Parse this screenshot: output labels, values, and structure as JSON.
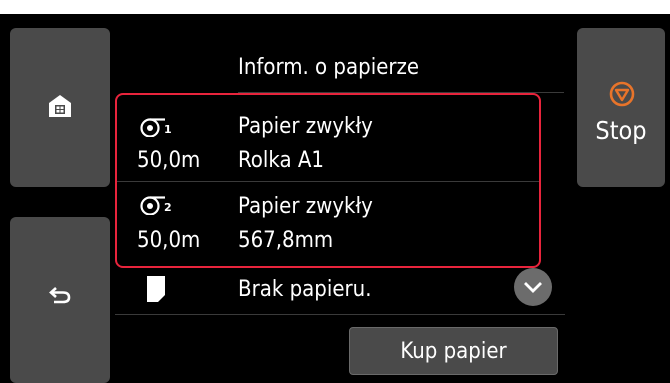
{
  "header": {
    "title": "Inform. o papierze"
  },
  "nav": {
    "home_icon": "home-icon",
    "back_icon": "back-arrow-icon"
  },
  "stop": {
    "label": "Stop",
    "icon": "stop-icon",
    "color": "#e8742a"
  },
  "rolls": [
    {
      "icon": "roll-1-icon",
      "length": "50,0m",
      "media": "Papier zwykły",
      "size": "Rolka A1"
    },
    {
      "icon": "roll-2-icon",
      "length": "50,0m",
      "media": "Papier zwykły",
      "size": "567,8mm"
    }
  ],
  "sheet": {
    "icon": "sheet-icon",
    "status": "Brak papieru."
  },
  "buy_button": {
    "label": "Kup papier"
  },
  "highlight_color": "#e8243c"
}
